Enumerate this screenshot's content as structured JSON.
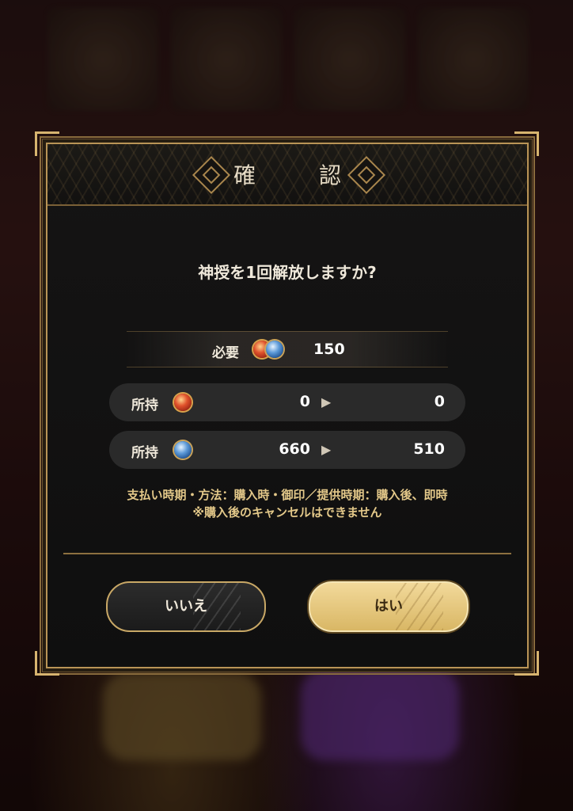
{
  "dialog": {
    "title": "確　認",
    "question": "神授を1回解放しますか?",
    "cost": {
      "label": "必要",
      "icon": "shin-ju-coin-icon",
      "value": "150"
    },
    "holdings": [
      {
        "label": "所持",
        "icon": "red-coin-icon",
        "before": "0",
        "after": "0"
      },
      {
        "label": "所持",
        "icon": "blue-coin-icon",
        "before": "660",
        "after": "510"
      }
    ],
    "notice_line1": "支払い時期・方法：購入時・御印／提供時期：購入後、即時",
    "notice_line2": "※購入後のキャンセルはできません",
    "buttons": {
      "no_label": "いいえ",
      "yes_label": "はい"
    }
  },
  "colors": {
    "gold": "#b99456",
    "yes_button": "#ecd08a",
    "panel": "#121212",
    "notice_text": "#e3c889"
  }
}
